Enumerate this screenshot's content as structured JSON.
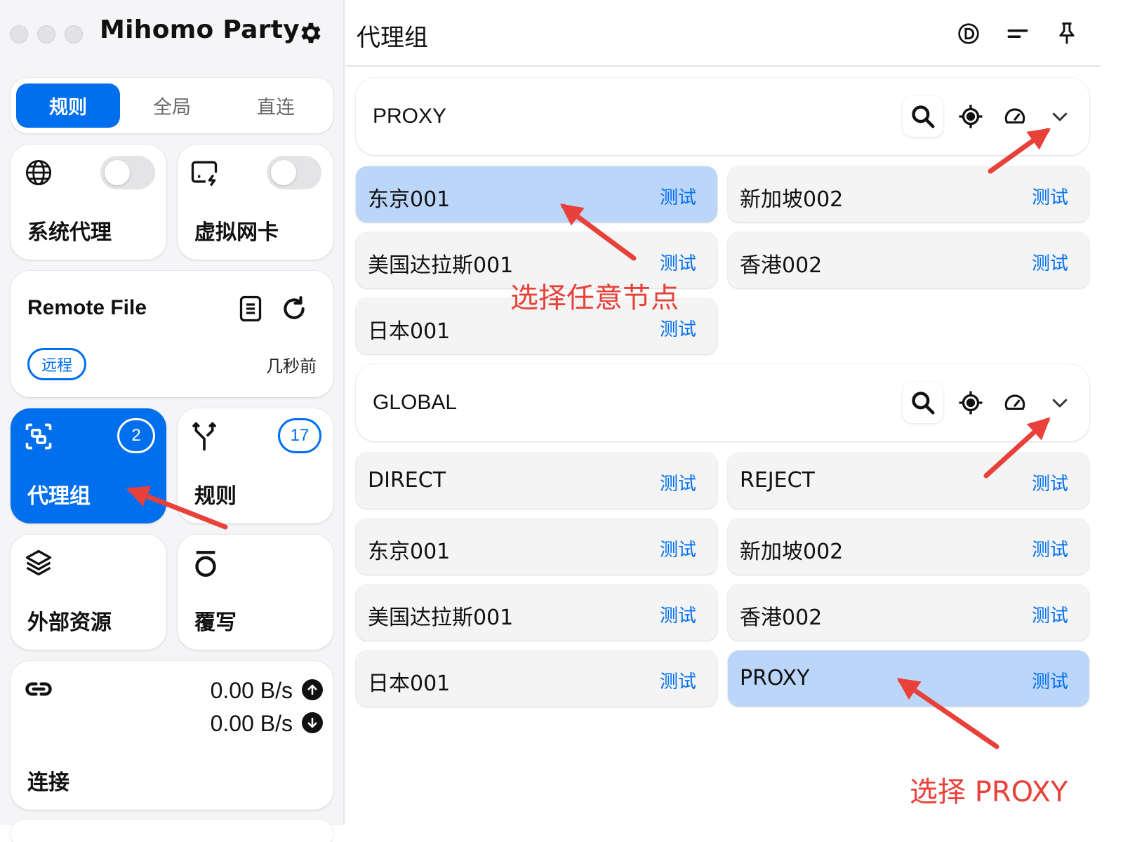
{
  "app": {
    "title": "Mihomo Party"
  },
  "sidebar": {
    "modes": [
      {
        "label": "规则",
        "active": true
      },
      {
        "label": "全局",
        "active": false
      },
      {
        "label": "直连",
        "active": false
      }
    ],
    "system_proxy": {
      "label": "系统代理",
      "icon": "globe-icon",
      "enabled": false
    },
    "tun": {
      "label": "虚拟网卡",
      "icon": "virtual-nic-icon",
      "enabled": false
    },
    "profile": {
      "name": "Remote File",
      "tag": "远程",
      "updated": "几秒前"
    },
    "proxy_groups": {
      "label": "代理组",
      "count": "2",
      "active": true
    },
    "rules": {
      "label": "规则",
      "count": "17"
    },
    "resources": {
      "label": "外部资源"
    },
    "override": {
      "label": "覆写"
    },
    "connections": {
      "label": "连接",
      "upload": "0.00 B/s",
      "download": "0.00 B/s"
    }
  },
  "header": {
    "title": "代理组"
  },
  "groups": [
    {
      "name": "PROXY",
      "proxies": [
        {
          "name": "东京001",
          "test": "测试",
          "selected": true
        },
        {
          "name": "新加坡002",
          "test": "测试",
          "selected": false
        },
        {
          "name": "美国达拉斯001",
          "test": "测试",
          "selected": false
        },
        {
          "name": "香港002",
          "test": "测试",
          "selected": false
        },
        {
          "name": "日本001",
          "test": "测试",
          "selected": false
        }
      ]
    },
    {
      "name": "GLOBAL",
      "proxies": [
        {
          "name": "DIRECT",
          "test": "测试",
          "selected": false
        },
        {
          "name": "REJECT",
          "test": "测试",
          "selected": false
        },
        {
          "name": "东京001",
          "test": "测试",
          "selected": false
        },
        {
          "name": "新加坡002",
          "test": "测试",
          "selected": false
        },
        {
          "name": "美国达拉斯001",
          "test": "测试",
          "selected": false
        },
        {
          "name": "香港002",
          "test": "测试",
          "selected": false
        },
        {
          "name": "日本001",
          "test": "测试",
          "selected": false
        },
        {
          "name": "PROXY",
          "test": "测试",
          "selected": true
        }
      ]
    }
  ],
  "annotations": {
    "select_node": "选择任意节点",
    "select_proxy": "选择 PROXY"
  },
  "colors": {
    "accent": "#006fee",
    "selected": "#bcd6f9",
    "annotation": "#e8413a"
  }
}
